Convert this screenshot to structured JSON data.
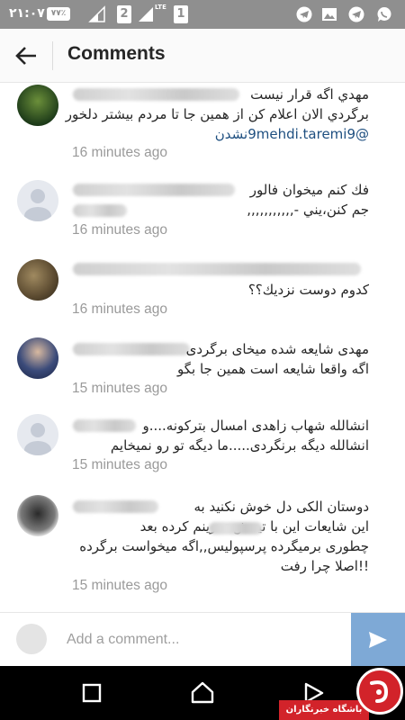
{
  "status_bar": {
    "time": "۲۱:۰۷",
    "badge": "۷۷٪",
    "sim1": "2",
    "sim2": "1",
    "network": "LTE"
  },
  "header": {
    "title": "Comments"
  },
  "comments": [
    {
      "lines": [
        "مهدي اگه قرار نیست",
        "برگردي الان اعلام كن از همين جا تا مردم بيشتر دلخور",
        "@9mehdi.taremi9نشدن"
      ],
      "time": "16 minutes ago"
    },
    {
      "lines": [
        "فك كنم ميخوان فالور",
        "جم كنن،يني -,,,,,,,,,,,"
      ],
      "time": "16 minutes ago"
    },
    {
      "lines": [
        "كدوم دوست نزديك؟؟"
      ],
      "time": "16 minutes ago"
    },
    {
      "lines": [
        "مهدی شایعه شده میخای برگردی",
        "اگه واقعا شایعه است همین جا بگو"
      ],
      "time": "15 minutes ago"
    },
    {
      "lines": [
        "انشالله شهاب زاهدی امسال بترکونه....و",
        "انشالله دیگه برنگردی.....ما دیگه تو رو نمیخایم"
      ],
      "time": "15 minutes ago"
    },
    {
      "lines": [
        "دوستان  الکی دل خوش نکنید به",
        "این شایعات این با تیمش تمرینم کرده بعد",
        "چطوری برمیگرده پرسپولیس,,اگه میخواست برگرده",
        "!!اصلا چرا رفت"
      ],
      "time": "15 minutes ago"
    }
  ],
  "input": {
    "placeholder": "Add a comment..."
  },
  "watermark": {
    "text": "باشگاه خبرنگاران"
  },
  "colors": {
    "status_bar": "#8f8f8f",
    "send_button": "#7ea9d6",
    "mention": "#1e4f80",
    "timestamp": "#9a9a9a"
  }
}
